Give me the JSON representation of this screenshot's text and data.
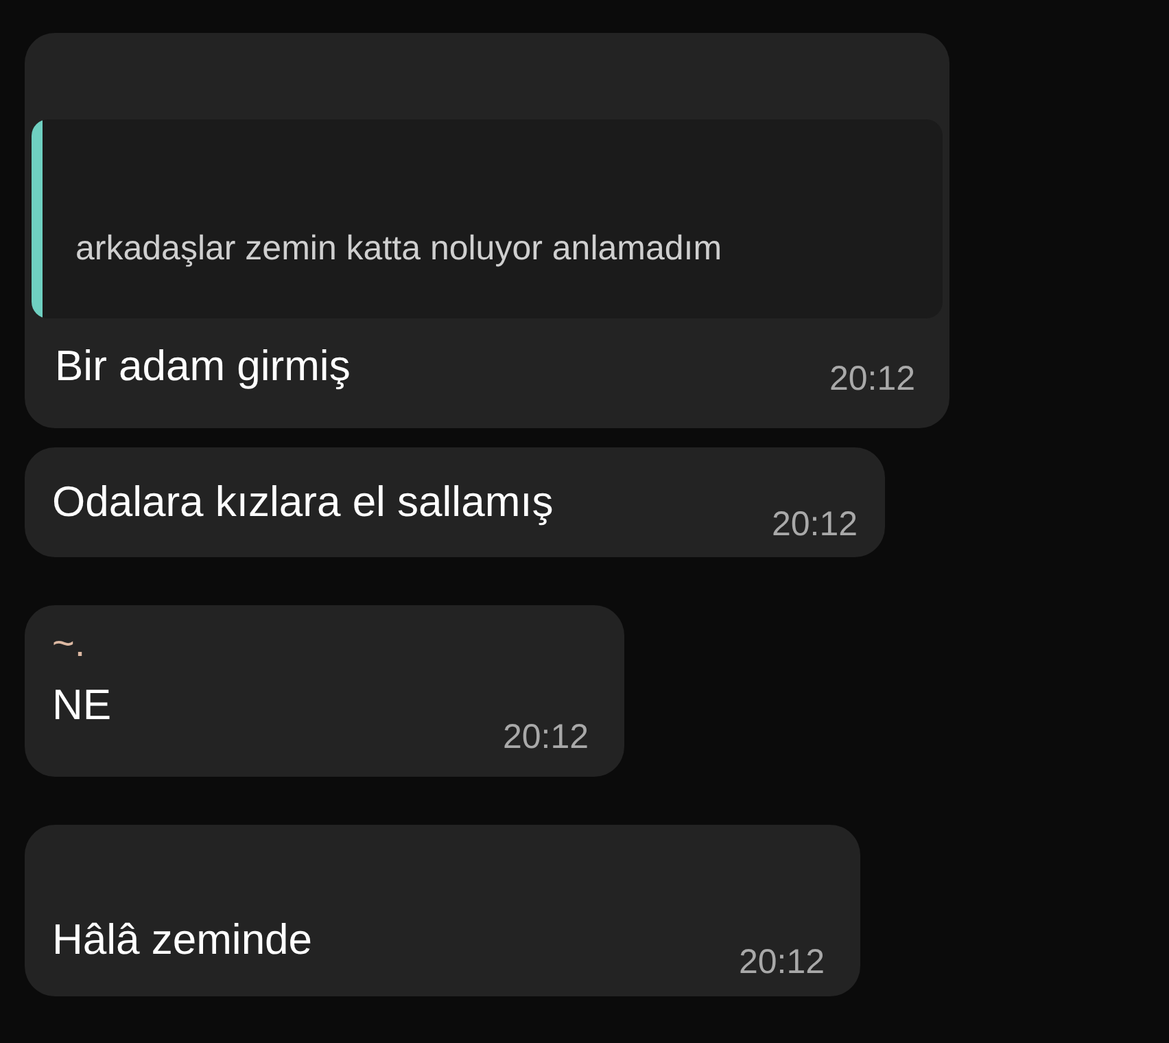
{
  "messages": [
    {
      "kind": "reply",
      "quote": "arkadaşlar zemin katta noluyor anlamadım",
      "text": "Bir adam girmiş",
      "time": "20:12"
    },
    {
      "kind": "plain",
      "text": "Odalara kızlara el sallamış",
      "time": "20:12"
    },
    {
      "kind": "sender",
      "sender": "~.",
      "text": "NE",
      "time": "20:12"
    },
    {
      "kind": "tall",
      "text": "Hâlâ zeminde",
      "time": "20:12"
    }
  ]
}
